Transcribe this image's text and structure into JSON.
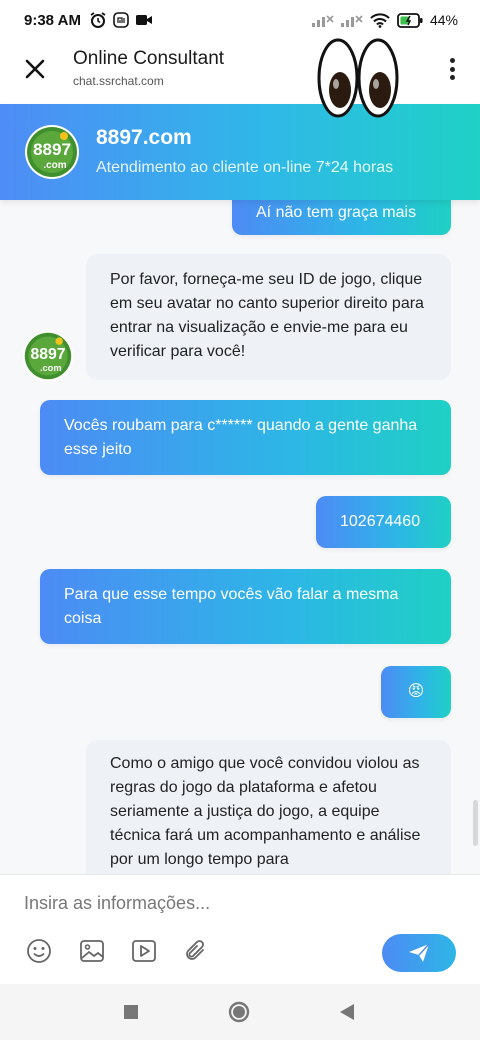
{
  "status_bar": {
    "time": "9:38 AM",
    "battery": "44%"
  },
  "browser": {
    "title": "Online Consultant",
    "url": "chat.ssrchat.com"
  },
  "chat_header": {
    "logo_text": "8897\n.com",
    "title": "8897.com",
    "subtitle": "Atendimento ao cliente on-line 7*24 horas"
  },
  "messages": [
    {
      "from": "me",
      "text": "Aí não tem graça mais"
    },
    {
      "from": "agent",
      "text": "Por favor, forneça-me seu ID de jogo, clique em seu avatar no canto superior direito para entrar na visualização e envie-me para eu verificar para você!"
    },
    {
      "from": "me",
      "text": "Vocês roubam para c****** quando a gente ganha esse jeito"
    },
    {
      "from": "me",
      "text": "102674460"
    },
    {
      "from": "me",
      "text": "Para que esse tempo vocês vão falar a mesma coisa"
    },
    {
      "from": "me",
      "text": "😡"
    },
    {
      "from": "agent",
      "text": "Como o amigo que você convidou violou as regras do jogo da plataforma e afetou seriamente a justiça do jogo, a equipe técnica fará um acompanhamento e análise por um longo tempo para"
    }
  ],
  "composer": {
    "placeholder": "Insira as informações..."
  },
  "colors": {
    "accent_start": "#4f8cf6",
    "accent_end": "#1fd1c6",
    "agent_bubble": "#eef1f6"
  },
  "icons": [
    "close-icon",
    "kebab-menu-icon",
    "emoji-icon",
    "image-icon",
    "video-icon",
    "attachment-icon",
    "send-icon",
    "nav-back-icon",
    "nav-home-icon",
    "nav-recents-icon"
  ]
}
